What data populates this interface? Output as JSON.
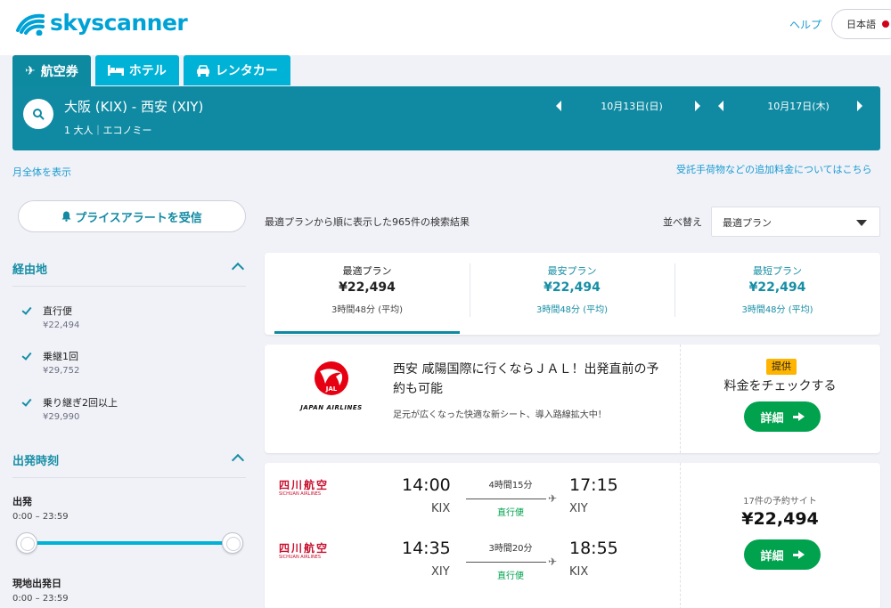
{
  "header": {
    "logo_text": "skyscanner",
    "help": "ヘルプ",
    "language": "日本語"
  },
  "tabs": [
    {
      "label": "航空券",
      "icon": "plane-icon"
    },
    {
      "label": "ホテル",
      "icon": "bed-icon"
    },
    {
      "label": "レンタカー",
      "icon": "car-icon"
    }
  ],
  "search": {
    "route": "大阪 (KIX) - 西安 (XIY)",
    "passengers": "1 大人｜エコノミー",
    "outbound_date": "10月13日(日)",
    "return_date": "10月17日(木)"
  },
  "links": {
    "show_month": "月全体を表示",
    "baggage_fees": "受託手荷物などの追加料金についてはこちら"
  },
  "sidebar": {
    "price_alert": "プライスアラートを受信",
    "stops_title": "経由地",
    "stops": [
      {
        "label": "直行便",
        "price": "¥22,494"
      },
      {
        "label": "乗継1回",
        "price": "¥29,752"
      },
      {
        "label": "乗り継ぎ2回以上",
        "price": "¥29,990"
      }
    ],
    "times_title": "出発時刻",
    "departure_label": "出発",
    "departure_range": "0:00 – 23:59",
    "local_departure_label": "現地出発日",
    "local_departure_range": "0:00 – 23:59"
  },
  "results": {
    "count_text": "最適プランから順に表示した965件の検索結果",
    "sort_label": "並べ替え",
    "sort_value": "最適プラン"
  },
  "summary": [
    {
      "title": "最適プラン",
      "price": "¥22,494",
      "duration": "3時間48分 (平均)"
    },
    {
      "title": "最安プラン",
      "price": "¥22,494",
      "duration": "3時間48分 (平均)"
    },
    {
      "title": "最短プラン",
      "price": "¥22,494",
      "duration": "3時間48分 (平均)"
    }
  ],
  "ad": {
    "airline_logo_text": "JAPAN AIRLINES",
    "jal_mark": "JAL",
    "title": "西安 咸陽国際に行くならＪＡＬ！出発直前の予約も可能",
    "subtitle": "足元が広くなった快適な新シート、導入路線拡大中！",
    "badge": "提供",
    "check_price": "料金をチェックする",
    "details_button": "詳細"
  },
  "flight": {
    "legs": [
      {
        "airline_cn": "四川航空",
        "airline_en": "SICHUAN AIRLINES",
        "dep_time": "14:00",
        "dep_code": "KIX",
        "duration": "4時間15分",
        "stops": "直行便",
        "arr_time": "17:15",
        "arr_code": "XIY"
      },
      {
        "airline_cn": "四川航空",
        "airline_en": "SICHUAN AIRLINES",
        "dep_time": "14:35",
        "dep_code": "XIY",
        "duration": "3時間20分",
        "stops": "直行便",
        "arr_time": "18:55",
        "arr_code": "KIX"
      }
    ],
    "sites": "17件の予約サイト",
    "price": "¥22,494",
    "details_button": "詳細"
  },
  "colors": {
    "brand": "#00a2d6",
    "search_bg": "#0f8aa2",
    "accent": "#168ea5",
    "cta": "#00a24e",
    "badge": "#ffb400"
  }
}
